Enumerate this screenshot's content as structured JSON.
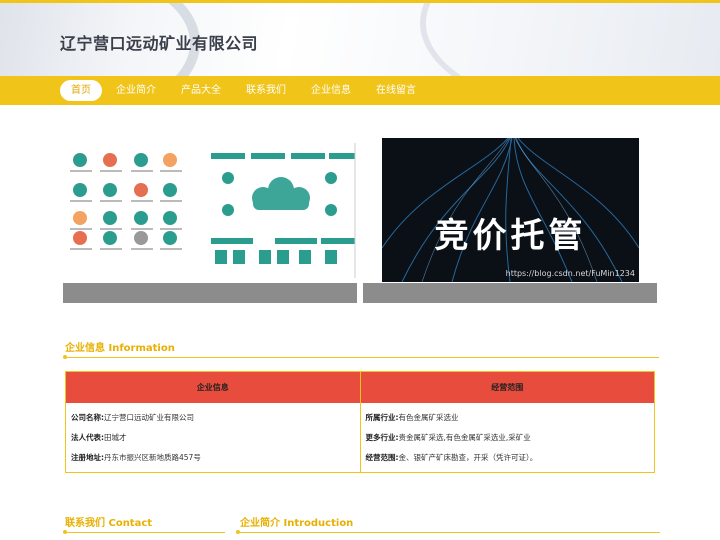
{
  "header": {
    "title": "辽宁营口远动矿业有限公司"
  },
  "nav": {
    "items": [
      "首页",
      "企业简介",
      "产品大全",
      "联系我们",
      "企业信息",
      "在线留言"
    ]
  },
  "banner2": {
    "text": "竞价托管",
    "url": "https://blog.csdn.net/FuMin1234"
  },
  "sections": {
    "info_title": "企业信息 Information",
    "contact_title": "联系我们 Contact",
    "intro_title": "企业简介 Introduction"
  },
  "info_table": {
    "head_left": "企业信息",
    "head_right": "经营范围",
    "left": [
      {
        "label": "公司名称:",
        "value": "辽宁营口远动矿业有限公司"
      },
      {
        "label": "法人代表:",
        "value": "田城才"
      },
      {
        "label": "注册地址:",
        "value": "丹东市振兴区新地质路457号"
      }
    ],
    "right": [
      {
        "label": "所属行业:",
        "value": "有色金属矿采选业"
      },
      {
        "label": "更多行业:",
        "value": "贵金属矿采选,有色金属矿采选业,采矿业"
      },
      {
        "label": "经营范围:",
        "value": "金、银矿产矿床勘查，开采（凭许可证）。"
      }
    ]
  },
  "colors": {
    "accent": "#f0c419",
    "table_head": "#e84c3d",
    "caption": "#8c8c8c"
  }
}
